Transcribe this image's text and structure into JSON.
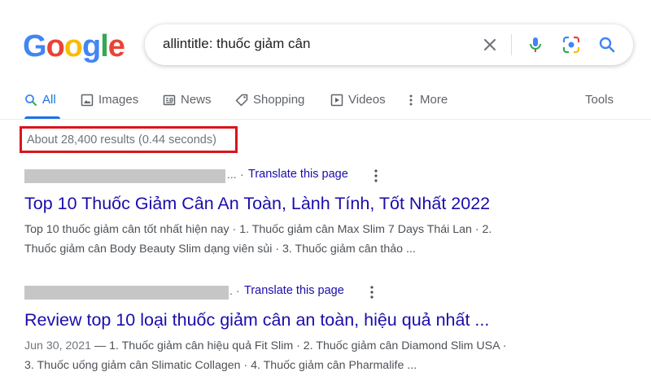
{
  "logo": {
    "letters": [
      "G",
      "o",
      "o",
      "g",
      "l",
      "e"
    ],
    "colors": [
      "#4285F4",
      "#EA4335",
      "#FBBC05",
      "#4285F4",
      "#34A853",
      "#EA4335"
    ]
  },
  "search": {
    "query": "allintitle: thuốc giảm cân",
    "icons": [
      "close-icon",
      "microphone-icon",
      "camera-lens-icon",
      "search-icon"
    ]
  },
  "tabs": [
    {
      "label": "All",
      "icon": "search-icon",
      "active": true
    },
    {
      "label": "Images",
      "icon": "image-icon"
    },
    {
      "label": "News",
      "icon": "news-icon"
    },
    {
      "label": "Shopping",
      "icon": "tag-icon"
    },
    {
      "label": "Videos",
      "icon": "play-icon"
    },
    {
      "label": "More",
      "icon": "more-vert-icon"
    }
  ],
  "tools_label": "Tools",
  "result_stats": "About 28,400 results (0.44 seconds)",
  "results": [
    {
      "cite_suffix": "...",
      "translate": "Translate this page",
      "title": "Top 10 Thuốc Giảm Cân An Toàn, Lành Tính, Tốt Nhất 2022",
      "snippet_line1": "Top 10 thuốc giảm cân tốt nhất hiện nay · 1. Thuốc giảm cân Max Slim 7 Days Thái Lan · 2.",
      "snippet_line2": "Thuốc giảm cân Body Beauty Slim dạng viên sủi · 3. Thuốc giảm cân thảo ..."
    },
    {
      "cite_suffix": ".",
      "translate": "Translate this page",
      "title": "Review top 10 loại thuốc giảm cân an toàn, hiệu quả nhất ...",
      "date": "Jun 30, 2021",
      "snippet_line1": " — 1. Thuốc giảm cân hiệu quả Fit Slim · 2. Thuốc giảm cân Diamond Slim USA ·",
      "snippet_line2": "3. Thuốc uống giảm cân Slimatic Collagen · 4. Thuốc giảm cân Pharmalife ..."
    }
  ],
  "colors": {
    "link": "#1a0dab",
    "accent": "#1a73e8",
    "highlight_box": "#d9141c"
  }
}
